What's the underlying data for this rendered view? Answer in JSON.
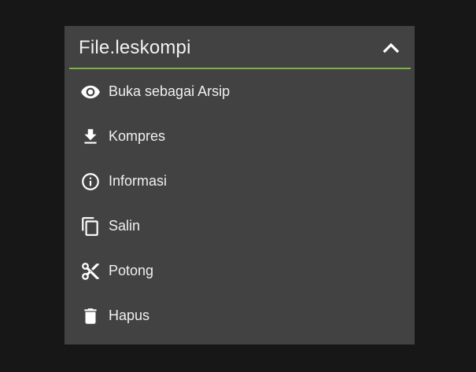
{
  "menu": {
    "title": "File.leskompi",
    "collapse_icon": "chevron-up-icon",
    "accent_color": "#7cb342",
    "background_color": "#424242",
    "items": [
      {
        "label": "Buka sebagai Arsip",
        "icon": "eye-icon"
      },
      {
        "label": "Kompres",
        "icon": "download-icon"
      },
      {
        "label": "Informasi",
        "icon": "info-icon"
      },
      {
        "label": "Salin",
        "icon": "copy-icon"
      },
      {
        "label": "Potong",
        "icon": "scissors-icon"
      },
      {
        "label": "Hapus",
        "icon": "trash-icon"
      }
    ]
  }
}
